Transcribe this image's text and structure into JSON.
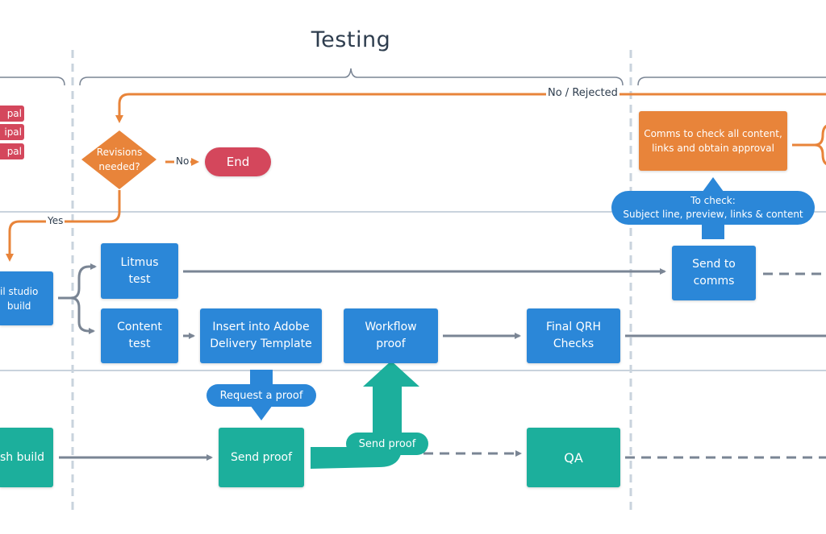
{
  "diagram": {
    "phase_title": "Testing",
    "left_tags": [
      "pal",
      "ipal",
      "pal"
    ],
    "nodes": {
      "revisions_decision": "Revisions\nneeded?",
      "end": "End",
      "email_studio_build": "il studio\nbuild",
      "litmus_test": "Litmus\ntest",
      "content_test": "Content\ntest",
      "insert_adobe": "Insert into Adobe\nDelivery Template",
      "workflow_proof": "Workflow\nproof",
      "final_qrh": "Final QRH\nChecks",
      "send_to_comms": "Send to\ncomms",
      "comms_check": "Comms to check all content,\nlinks and obtain approval",
      "finish_build": "sh build",
      "send_proof": "Send proof",
      "qa": "QA"
    },
    "callouts": {
      "request_proof": "Request a proof",
      "send_proof_arrow": "Send proof",
      "to_check": "To check:\nSubject line, preview, links & content"
    },
    "edge_labels": {
      "no": "No",
      "yes": "Yes",
      "no_rejected": "No / Rejected"
    },
    "colors": {
      "blue": "#2b87d8",
      "green": "#1caf9c",
      "orange": "#e8843a",
      "red": "#d4475c",
      "connector": "#7a8594",
      "lane_line": "#c9d3dd"
    }
  }
}
